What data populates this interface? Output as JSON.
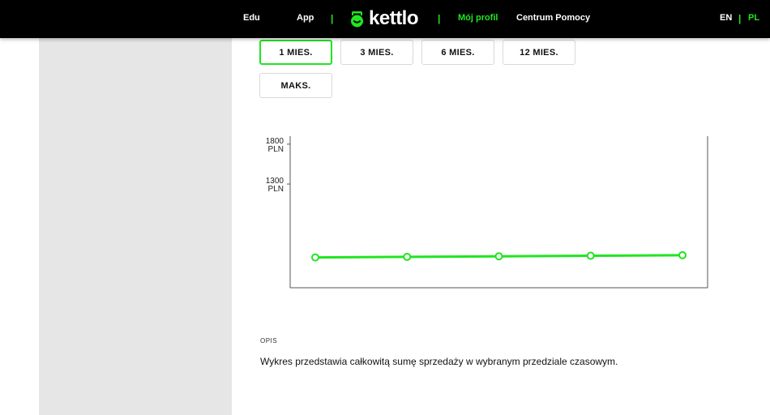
{
  "nav": {
    "edu": "Edu",
    "app": "App",
    "separator": "|",
    "brand": "kettlo",
    "profile": "Mój profil",
    "help": "Centrum Pomocy",
    "lang_en": "EN",
    "lang_pl": "PL",
    "active_color": "#21e521"
  },
  "ranges": {
    "items": [
      "1 MIES.",
      "3 MIES.",
      "6 MIES.",
      "12 MIES.",
      "MAKS."
    ],
    "selected": "1 MIES."
  },
  "chart_data": {
    "type": "line",
    "title": "",
    "xlabel": "",
    "ylabel": "",
    "yticks": [
      {
        "value": 1800,
        "line1": "1800",
        "line2": "PLN"
      },
      {
        "value": 1300,
        "line1": "1300",
        "line2": "PLN"
      }
    ],
    "ylim": [
      0,
      1900
    ],
    "x": [
      1,
      2,
      3,
      4,
      5
    ],
    "series": [
      {
        "values": [
          380,
          387,
          394,
          401,
          408
        ]
      }
    ],
    "color": "#21e521",
    "grid": false
  },
  "description": {
    "heading": "OPIS",
    "text": "Wykres przedstawia całkowitą sumę sprzedaży w wybranym przedziale czasowym."
  }
}
